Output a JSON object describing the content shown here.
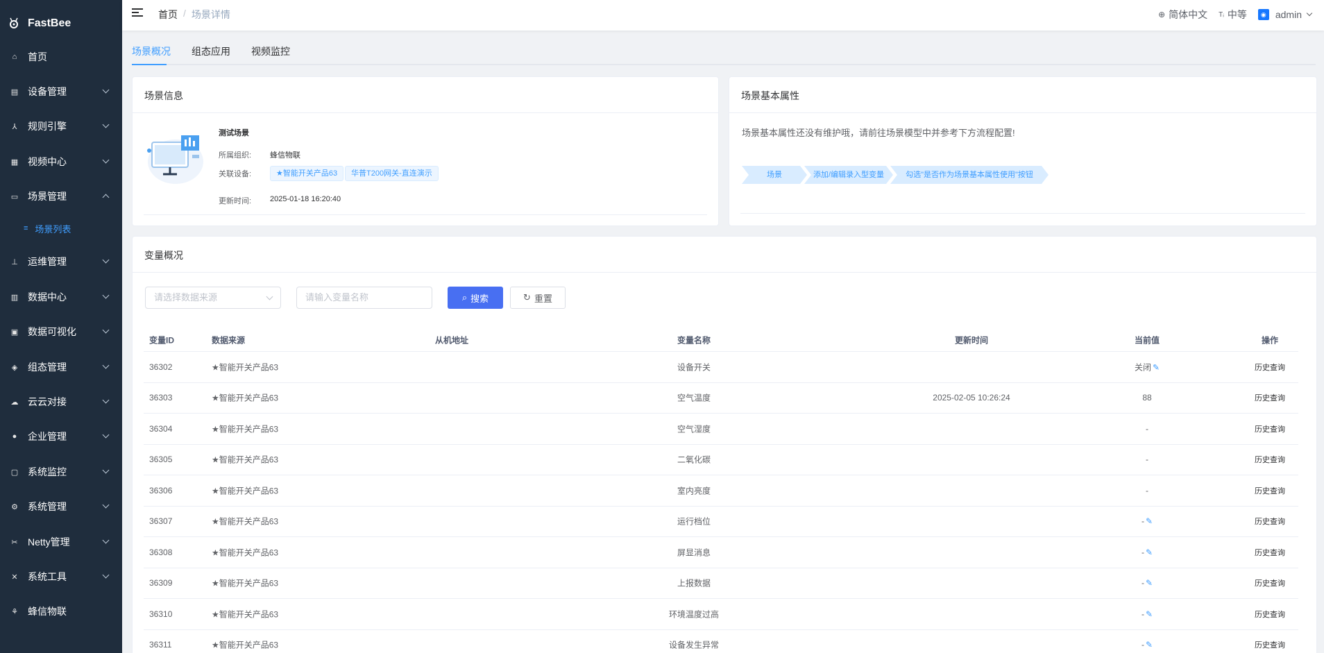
{
  "app": {
    "name": "FastBee"
  },
  "sidebar": {
    "items": [
      {
        "label": "首页",
        "icon": "home-icon",
        "glyph": "⌂",
        "expand": false
      },
      {
        "label": "设备管理",
        "icon": "device-icon",
        "glyph": "▤",
        "expand": true
      },
      {
        "label": "规则引擎",
        "icon": "rule-icon",
        "glyph": "⅄",
        "expand": true
      },
      {
        "label": "视频中心",
        "icon": "video-icon",
        "glyph": "▦",
        "expand": true
      },
      {
        "label": "场景管理",
        "icon": "scene-icon",
        "glyph": "▭",
        "expand": true,
        "open": true
      },
      {
        "label": "运维管理",
        "icon": "ops-icon",
        "glyph": "⊥",
        "expand": true
      },
      {
        "label": "数据中心",
        "icon": "data-icon",
        "glyph": "▥",
        "expand": true
      },
      {
        "label": "数据可视化",
        "icon": "visual-icon",
        "glyph": "▣",
        "expand": true
      },
      {
        "label": "组态管理",
        "icon": "config-icon",
        "glyph": "◈",
        "expand": true
      },
      {
        "label": "云云对接",
        "icon": "cloud-icon",
        "glyph": "☁",
        "expand": true
      },
      {
        "label": "企业管理",
        "icon": "enterprise-icon",
        "glyph": "●",
        "expand": true
      },
      {
        "label": "系统监控",
        "icon": "monitor-icon",
        "glyph": "▢",
        "expand": true
      },
      {
        "label": "系统管理",
        "icon": "system-icon",
        "glyph": "⚙",
        "expand": true
      },
      {
        "label": "Netty管理",
        "icon": "netty-icon",
        "glyph": "✂",
        "expand": true
      },
      {
        "label": "系统工具",
        "icon": "tools-icon",
        "glyph": "✕",
        "expand": true
      },
      {
        "label": "蜂信物联",
        "icon": "bee-icon",
        "glyph": "⚘",
        "expand": false
      }
    ],
    "submenu": {
      "label": "场景列表"
    }
  },
  "header": {
    "breadcrumb": [
      "首页",
      "场景详情"
    ],
    "language": "简体中文",
    "size": "中等",
    "user": "admin"
  },
  "tabs": [
    "场景概况",
    "组态应用",
    "视频监控"
  ],
  "scene_info": {
    "title": "场景信息",
    "name": "测试场景",
    "org_label": "所属组织:",
    "org_value": "蜂信物联",
    "device_label": "关联设备:",
    "devices": [
      "★智能开关产品63",
      "华普T200网关-直连演示"
    ],
    "time_label": "更新时间:",
    "time_value": "2025-01-18 16:20:40"
  },
  "scene_attrs": {
    "title": "场景基本属性",
    "message": "场景基本属性还没有维护哦，请前往场景模型中并参考下方流程配置!",
    "steps": [
      "场景",
      "添加/编辑录入型变量",
      "勾选\"是否作为场景基本属性使用\"按钮"
    ]
  },
  "variables": {
    "title": "变量概况",
    "source_placeholder": "请选择数据来源",
    "name_placeholder": "请输入变量名称",
    "search_label": "搜索",
    "reset_label": "重置",
    "columns": [
      "变量ID",
      "数据来源",
      "从机地址",
      "变量名称",
      "更新时间",
      "当前值",
      "操作"
    ],
    "rows": [
      {
        "id": "36302",
        "source": "★智能开关产品63",
        "slave": "",
        "name": "设备开关",
        "time": "",
        "value": "关闭",
        "editable": true,
        "action": "历史查询"
      },
      {
        "id": "36303",
        "source": "★智能开关产品63",
        "slave": "",
        "name": "空气温度",
        "time": "2025-02-05 10:26:24",
        "value": "88",
        "editable": false,
        "action": "历史查询"
      },
      {
        "id": "36304",
        "source": "★智能开关产品63",
        "slave": "",
        "name": "空气湿度",
        "time": "",
        "value": "-",
        "editable": false,
        "action": "历史查询"
      },
      {
        "id": "36305",
        "source": "★智能开关产品63",
        "slave": "",
        "name": "二氧化碳",
        "time": "",
        "value": "-",
        "editable": false,
        "action": "历史查询"
      },
      {
        "id": "36306",
        "source": "★智能开关产品63",
        "slave": "",
        "name": "室内亮度",
        "time": "",
        "value": "-",
        "editable": false,
        "action": "历史查询"
      },
      {
        "id": "36307",
        "source": "★智能开关产品63",
        "slave": "",
        "name": "运行档位",
        "time": "",
        "value": "-",
        "editable": true,
        "action": "历史查询"
      },
      {
        "id": "36308",
        "source": "★智能开关产品63",
        "slave": "",
        "name": "屏显消息",
        "time": "",
        "value": "-",
        "editable": true,
        "action": "历史查询"
      },
      {
        "id": "36309",
        "source": "★智能开关产品63",
        "slave": "",
        "name": "上报数据",
        "time": "",
        "value": "-",
        "editable": true,
        "action": "历史查询"
      },
      {
        "id": "36310",
        "source": "★智能开关产品63",
        "slave": "",
        "name": "环境温度过高",
        "time": "",
        "value": "-",
        "editable": true,
        "action": "历史查询"
      },
      {
        "id": "36311",
        "source": "★智能开关产品63",
        "slave": "",
        "name": "设备发生异常",
        "time": "",
        "value": "-",
        "editable": true,
        "action": "历史查询"
      }
    ]
  }
}
